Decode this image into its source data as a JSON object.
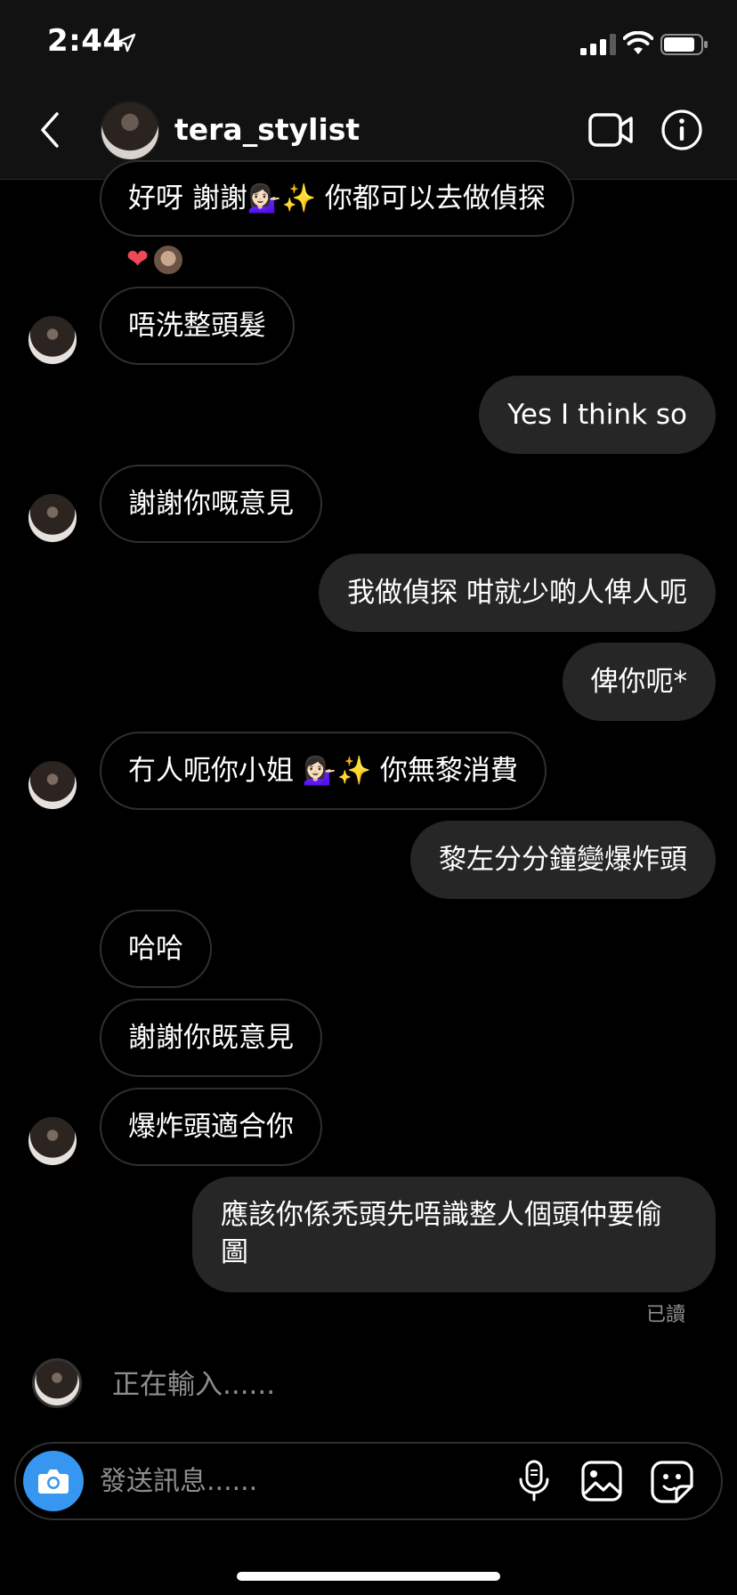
{
  "status_bar": {
    "time": "2:44"
  },
  "header": {
    "username": "tera_stylist",
    "icons": [
      "back-arrow-icon",
      "video-call-icon",
      "info-icon"
    ]
  },
  "messages": [
    {
      "from": "them",
      "text": "好呀 謝謝💁🏻‍♀️✨ 你都可以去做偵探"
    },
    {
      "from": "them",
      "text": "唔洗整頭髮"
    },
    {
      "from": "me",
      "text": "Yes I think so"
    },
    {
      "from": "them",
      "text": "謝謝你嘅意見"
    },
    {
      "from": "me",
      "text": "我做偵探 咁就少啲人俾人呃"
    },
    {
      "from": "me",
      "text": "俾你呃*"
    },
    {
      "from": "them",
      "text": "冇人呃你小姐 💁🏻‍♀️✨ 你無黎消費"
    },
    {
      "from": "me",
      "text": "黎左分分鐘變爆炸頭"
    },
    {
      "from": "them",
      "text": "哈哈"
    },
    {
      "from": "them",
      "text": "謝謝你既意見"
    },
    {
      "from": "them",
      "text": "爆炸頭適合你"
    },
    {
      "from": "me",
      "text": "應該你係禿頭先唔識整人個頭仲要偷圖"
    }
  ],
  "reaction": {
    "emoji": "❤"
  },
  "seen_label": "已讀",
  "typing_label": "正在輸入......",
  "composer": {
    "placeholder": "發送訊息......"
  },
  "colors": {
    "accent": "#3797f0",
    "outgoing_bubble": "#262626",
    "incoming_border": "#2f2f2f",
    "reaction_heart": "#ed4956"
  }
}
